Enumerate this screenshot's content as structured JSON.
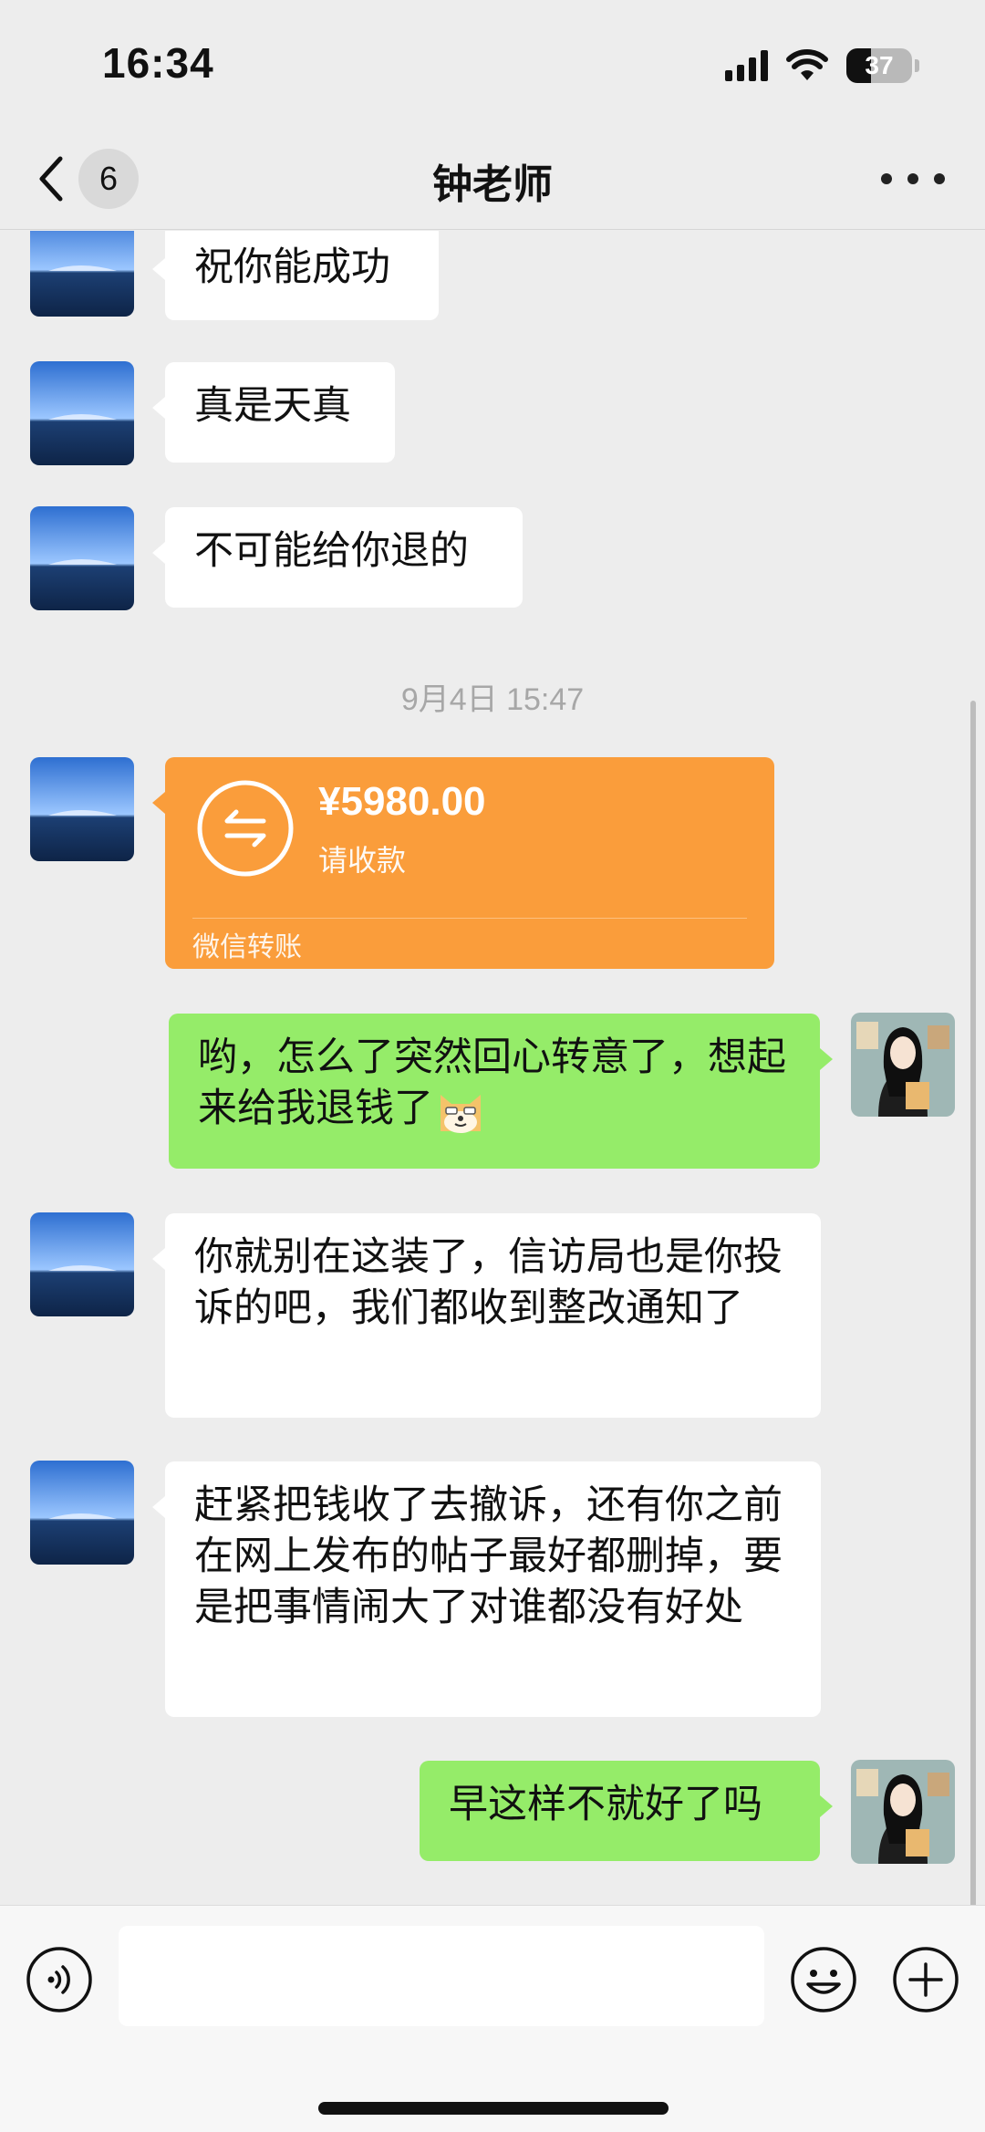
{
  "status_bar": {
    "time": "16:34",
    "battery": "37",
    "battery_level": 0.37
  },
  "nav": {
    "back_count": "6",
    "title": "钟老师"
  },
  "messages": {
    "m1": "祝你能成功",
    "m2": "真是天真",
    "m3": "不可能给你退的",
    "timestamp": "9月4日 15:47",
    "transfer": {
      "amount": "¥5980.00",
      "status": "请收款",
      "source": "微信转账"
    },
    "m4": "哟，怎么了突然回心转意了，想起来给我退钱了",
    "m5": "你就别在这装了，信访局也是你投诉的吧，我们都收到整改通知了",
    "m6": "赶紧把钱收了去撤诉，还有你之前在网上发布的帖子最好都删掉，要是把事情闹大了对谁都没有好处",
    "m7": "早这样不就好了吗"
  },
  "input": {
    "value": "",
    "placeholder": ""
  },
  "colors": {
    "background": "#ededed",
    "incoming_bubble": "#ffffff",
    "outgoing_bubble": "#95ec69",
    "transfer_card": "#fa9d3b",
    "timestamp_text": "#a7a7a7"
  },
  "icons": [
    "back-icon",
    "signal-icon",
    "wifi-icon",
    "battery-icon",
    "more-icon",
    "transfer-icon",
    "doge-emoji",
    "voice-icon",
    "emoji-icon",
    "plus-icon"
  ]
}
